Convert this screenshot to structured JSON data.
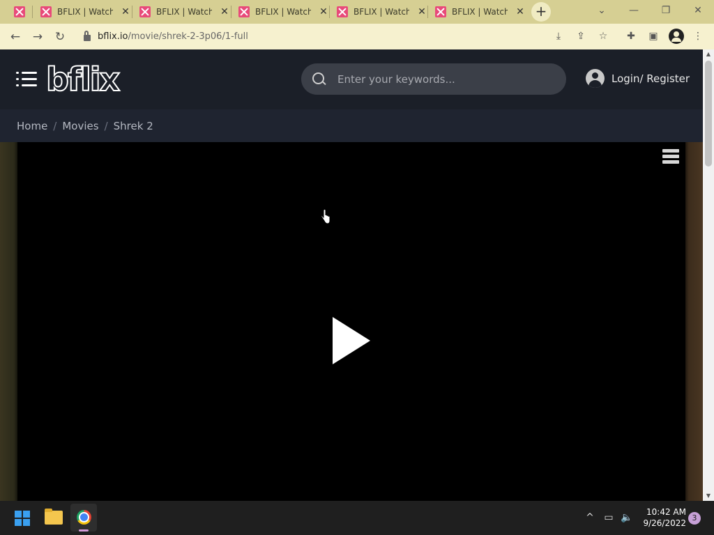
{
  "browser": {
    "tabs": [
      {
        "title": "BFLIX | Watch"
      },
      {
        "title": "BFLIX | Watch"
      },
      {
        "title": "BFLIX | Watch"
      },
      {
        "title": "BFLIX | Watch"
      },
      {
        "title": "BFLIX | Watch"
      }
    ],
    "new_tab_label": "+",
    "url_host": "bflix.io",
    "url_path": "/movie/shrek-2-3p06/1-full"
  },
  "site": {
    "logo": "bflix",
    "search_placeholder": "Enter your keywords...",
    "login_label": "Login/ Register",
    "breadcrumb": {
      "home": "Home",
      "movies": "Movies",
      "current": "Shrek 2"
    }
  },
  "taskbar": {
    "time": "10:42 AM",
    "date": "9/26/2022",
    "notification_count": "3"
  },
  "colors": {
    "chrome_frame": "#d6cf93",
    "toolbar": "#f6f1cf",
    "page_bg": "#161a22",
    "accent_tab_icon": "#e84a7a"
  }
}
